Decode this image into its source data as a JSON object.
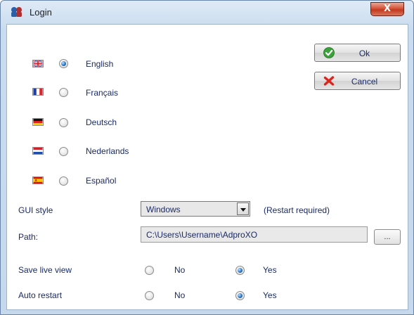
{
  "window": {
    "title": "Login",
    "close_label": "X"
  },
  "languages": [
    {
      "label": "English",
      "flag": "uk-flag-icon",
      "checked": true
    },
    {
      "label": "Français",
      "flag": "france-flag-icon",
      "checked": false
    },
    {
      "label": "Deutsch",
      "flag": "germany-flag-icon",
      "checked": false
    },
    {
      "label": "Nederlands",
      "flag": "netherlands-flag-icon",
      "checked": false
    },
    {
      "label": "Español",
      "flag": "spain-flag-icon",
      "checked": false
    }
  ],
  "buttons": {
    "ok_label": "Ok",
    "cancel_label": "Cancel"
  },
  "gui_style": {
    "label": "GUI style",
    "value": "Windows",
    "note": "(Restart required)"
  },
  "path": {
    "label": "Path:",
    "value": "C:\\Users\\Username\\AdproXO",
    "browse_label": "..."
  },
  "save_live_view": {
    "label": "Save live view",
    "no_label": "No",
    "yes_label": "Yes",
    "selected": "Yes"
  },
  "auto_restart": {
    "label": "Auto restart",
    "no_label": "No",
    "yes_label": "Yes",
    "selected": "Yes"
  },
  "colors": {
    "title_bar": "#c9dcef",
    "close_button": "#c0391f",
    "text": "#1a2a66",
    "radio_selected": "#1f6fbf"
  }
}
